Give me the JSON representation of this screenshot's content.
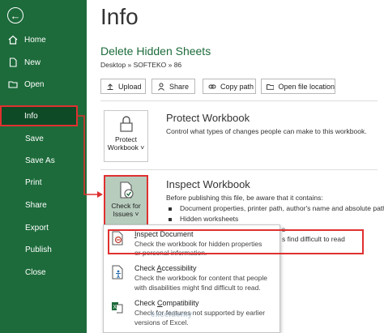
{
  "sidebar": {
    "items": [
      {
        "label": "Home",
        "icon": "home-icon"
      },
      {
        "label": "New",
        "icon": "new-file-icon"
      },
      {
        "label": "Open",
        "icon": "folder-icon"
      },
      {
        "label": "Info"
      },
      {
        "label": "Save"
      },
      {
        "label": "Save As"
      },
      {
        "label": "Print"
      },
      {
        "label": "Share"
      },
      {
        "label": "Export"
      },
      {
        "label": "Publish"
      },
      {
        "label": "Close"
      }
    ]
  },
  "header": {
    "title": "Info",
    "doc_title": "Delete Hidden Sheets",
    "path": "Desktop » SOFTEKO » 86"
  },
  "actions": {
    "upload": "Upload",
    "share": "Share",
    "copy_path": "Copy path",
    "open_location": "Open file location"
  },
  "protect": {
    "button_line1": "Protect",
    "button_line2": "Workbook ˅",
    "title": "Protect Workbook",
    "description": "Control what types of changes people can make to this workbook."
  },
  "inspect": {
    "button_line1": "Check for",
    "button_line2": "Issues ˅",
    "title": "Inspect Workbook",
    "intro": "Before publishing this file, be aware that it contains:",
    "bullets": [
      "Document properties, printer path, author's name and absolute path",
      "Hidden worksheets"
    ],
    "clipped_text_1": "s",
    "clipped_text_2": "s find difficult to read"
  },
  "dropdown": {
    "items": [
      {
        "title_prefix": "",
        "title_underlined": "I",
        "title_suffix": "nspect Document",
        "line1": "Check the workbook for hidden properties",
        "line2": "or personal information."
      },
      {
        "title_prefix": "Check ",
        "title_underlined": "A",
        "title_suffix": "ccessibility",
        "line1": "Check the workbook for content that people",
        "line2": "with disabilities might find difficult to read."
      },
      {
        "title_prefix": "Check ",
        "title_underlined": "C",
        "title_suffix": "ompatibility",
        "line1": "Check for features not supported by earlier",
        "line2": "versions of Excel."
      }
    ]
  },
  "watermark": "exceldemy",
  "colors": {
    "sidebar": "#1d6b3b",
    "highlight": "#e03030",
    "accent": "#1d6b3b"
  }
}
